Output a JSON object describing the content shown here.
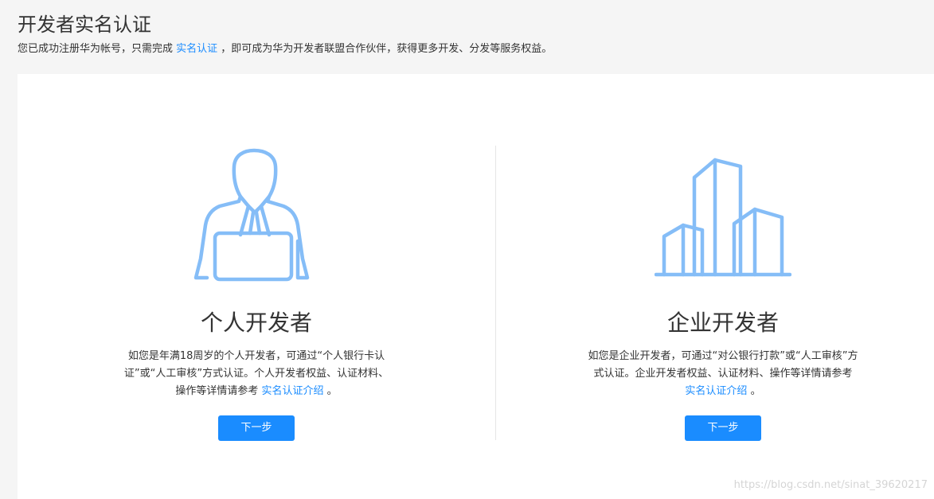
{
  "header": {
    "title": "开发者实名认证",
    "subtitle_before": "您已成功注册华为帐号，只需完成 ",
    "subtitle_link": "实名认证",
    "subtitle_after": " ，即可成为华为开发者联盟合作伙伴，获得更多开发、分发等服务权益。"
  },
  "cards": [
    {
      "icon": "person-laptop-icon",
      "title": "个人开发者",
      "desc_before": "如您是年满18周岁的个人开发者，可通过“个人银行卡认证”或“人工审核”方式认证。个人开发者权益、认证材料、操作等详情请参考 ",
      "desc_link": "实名认证介绍",
      "desc_after": " 。",
      "button": "下一步"
    },
    {
      "icon": "buildings-icon",
      "title": "企业开发者",
      "desc_before": "如您是企业开发者，可通过“对公银行打款”或“人工审核”方式认证。企业开发者权益、认证材料、操作等详情请参考 ",
      "desc_link": "实名认证介绍",
      "desc_after": " 。",
      "button": "下一步"
    }
  ],
  "watermark": "https://blog.csdn.net/sinat_39620217",
  "colors": {
    "accent": "#1a8cff",
    "icon_stroke": "#85bdf7",
    "background": "#f5f5f5",
    "panel": "#ffffff"
  }
}
